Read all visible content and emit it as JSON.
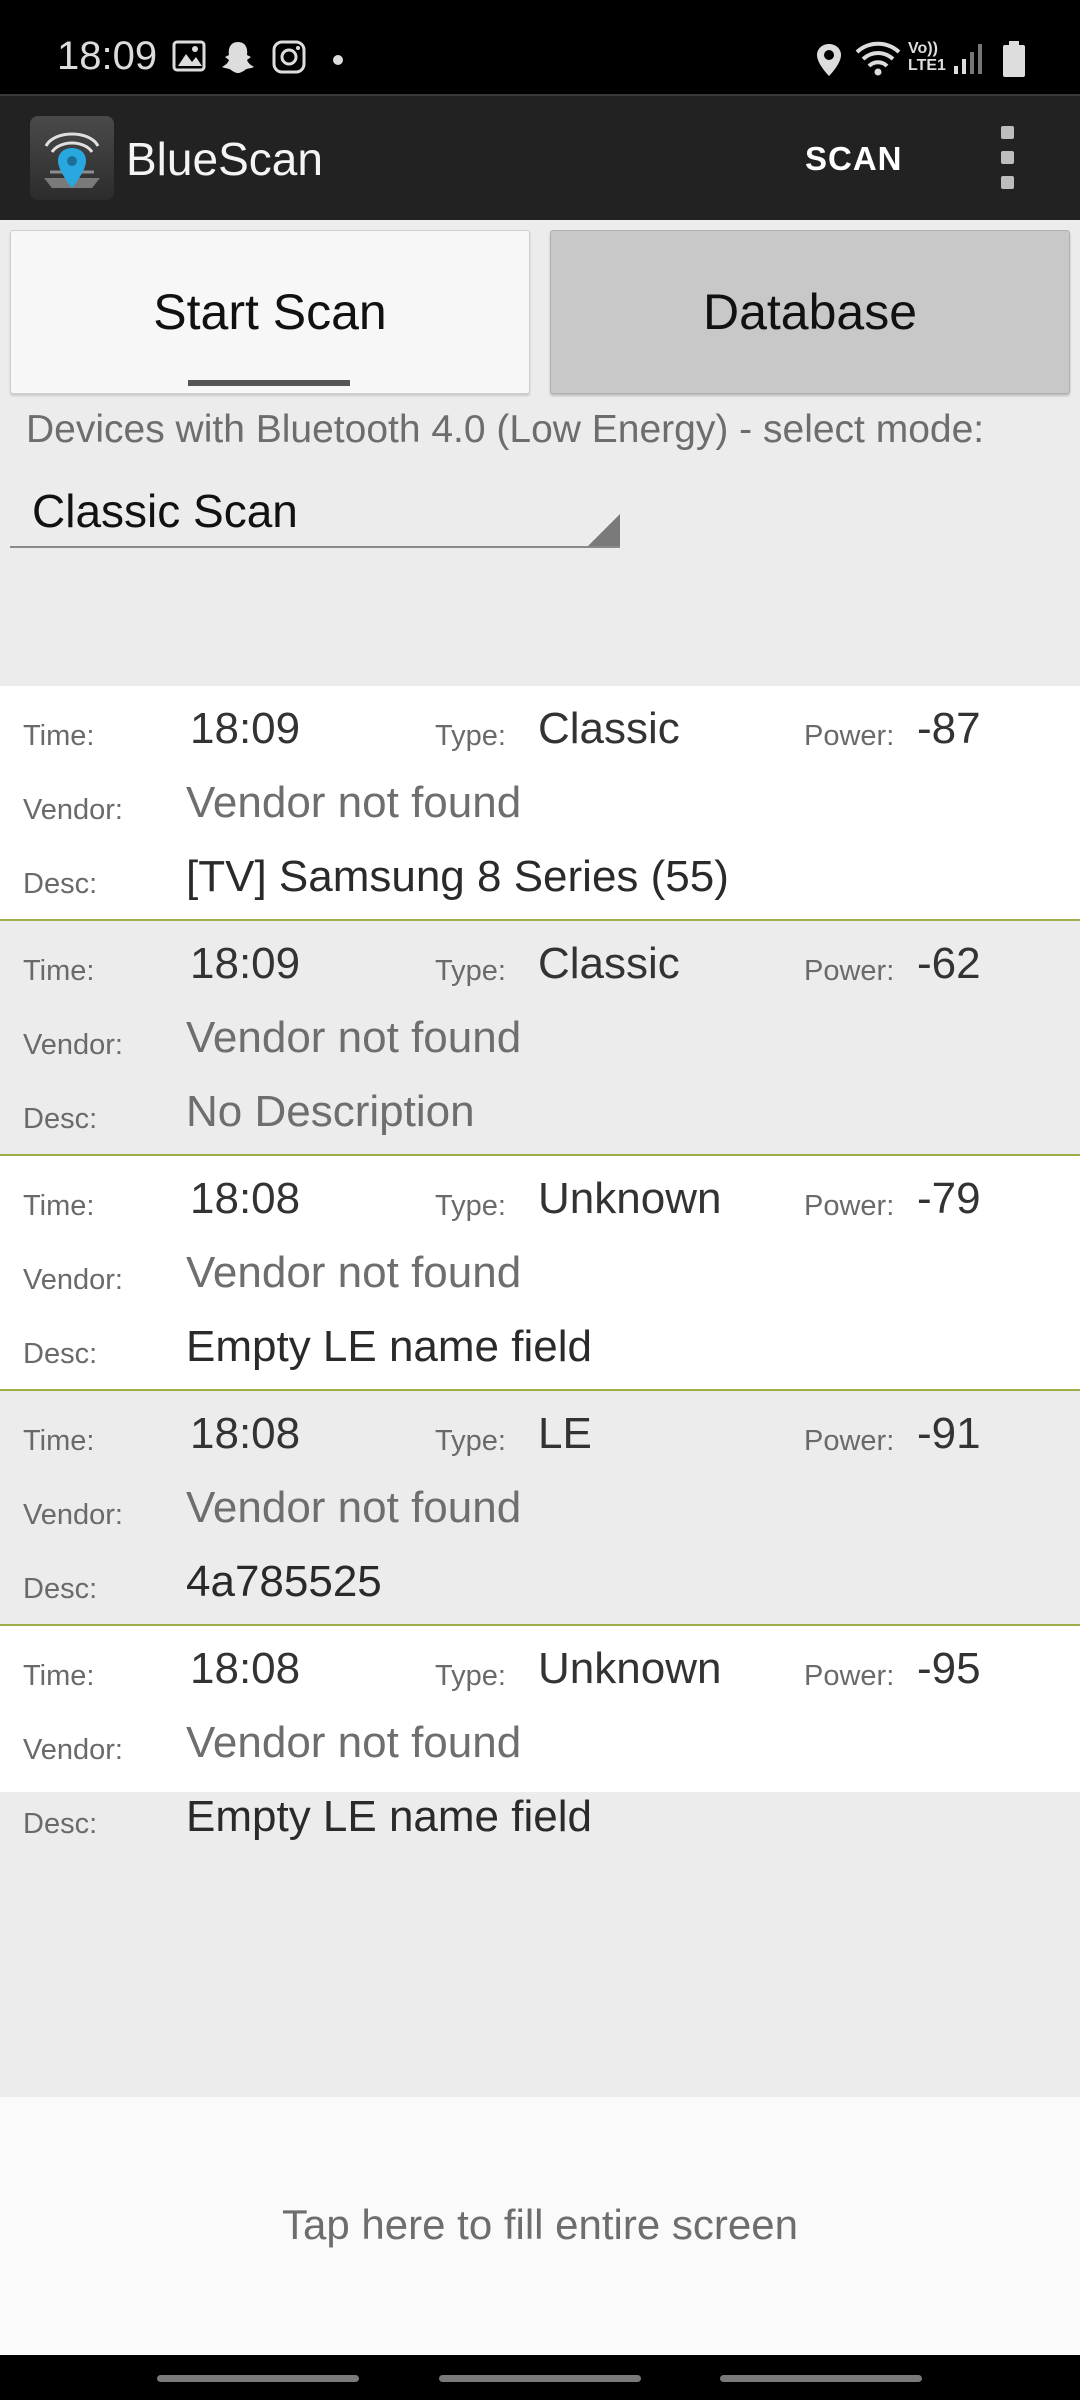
{
  "status_bar": {
    "time": "18:09",
    "icons": [
      "image-icon",
      "snapchat-icon",
      "instagram-icon",
      "dot-icon",
      "location-icon",
      "wifi-icon",
      "volte-icon",
      "signal-icon",
      "battery-icon"
    ],
    "volte_line1": "Vo))",
    "volte_line2": "LTE1"
  },
  "app_bar": {
    "title": "BlueScan",
    "scan_action": "SCAN",
    "logo_icon": "bluescan-logo-icon",
    "menu_icon": "overflow-menu-icon"
  },
  "tabs": [
    {
      "label": "Start Scan",
      "selected": true
    },
    {
      "label": "Database",
      "selected": false
    }
  ],
  "mode": {
    "label": "Devices with Bluetooth 4.0 (Low Energy) - select mode:",
    "selected": "Classic Scan"
  },
  "list_labels": {
    "time": "Time:",
    "type": "Type:",
    "power": "Power:",
    "vendor": "Vendor:",
    "desc": "Desc:"
  },
  "devices": [
    {
      "time": "18:09",
      "type": "Classic",
      "power": "-87",
      "vendor": "Vendor not found",
      "desc": "[TV] Samsung 8 Series (55)"
    },
    {
      "time": "18:09",
      "type": "Classic",
      "power": "-62",
      "vendor": "Vendor not found",
      "desc": "No Description"
    },
    {
      "time": "18:08",
      "type": "Unknown",
      "power": "-79",
      "vendor": "Vendor not found",
      "desc": "Empty LE name field"
    },
    {
      "time": "18:08",
      "type": "LE",
      "power": "-91",
      "vendor": "Vendor not found",
      "desc": "4a785525"
    },
    {
      "time": "18:08",
      "type": "Unknown",
      "power": "-95",
      "vendor": "Vendor not found",
      "desc": "Empty LE name field"
    }
  ],
  "fill_banner": {
    "text": "Tap here to fill entire screen"
  },
  "colors": {
    "accent_divider": "#9cb04a",
    "app_bar": "#222222",
    "logo_pin": "#29a8e0"
  }
}
